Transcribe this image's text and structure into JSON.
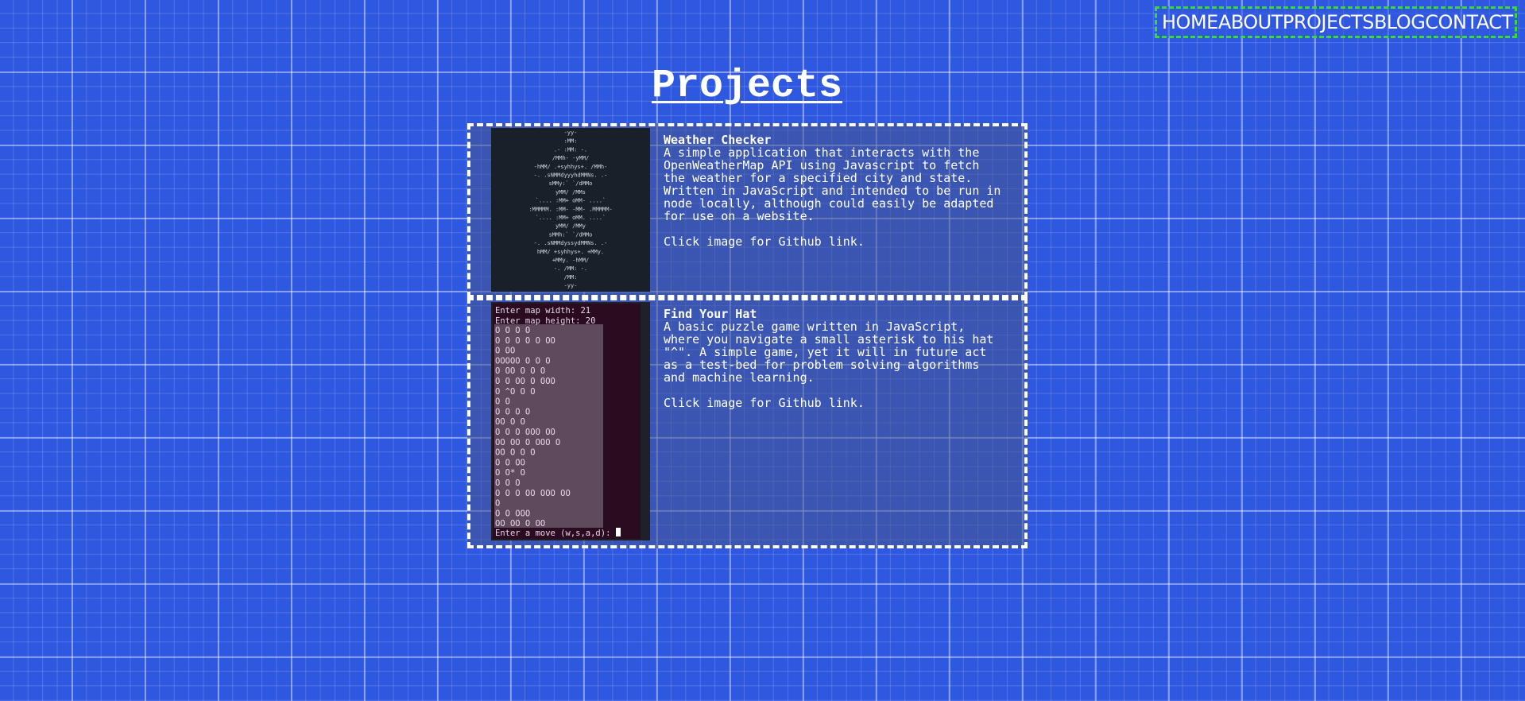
{
  "nav": {
    "items": [
      {
        "label": "HOME"
      },
      {
        "label": "ABOUT"
      },
      {
        "label": "PROJECTS"
      },
      {
        "label": "BLOG"
      },
      {
        "label": "CONTACT"
      }
    ]
  },
  "page": {
    "title": "Projects"
  },
  "projects": [
    {
      "title": "Weather Checker",
      "description": "A simple application that interacts with the OpenWeatherMap API using Javascript to fetch the weather for a specified city and state. Written in JavaScript and intended to be run in node locally, although could easily be adapted for use on a website.",
      "link_note": "Click image for Github link.",
      "image": {
        "ascii": [
          "-yy-",
          ":MM:",
          ".-         :MM:         -.",
          "/MMh-                  -yMM/",
          "-hMM/  .+syhhys+.  /MMh-",
          "-. .sNMMdyyyhdMMNs. .-",
          "sMMy:`       `/dMMo",
          "yMM/            /MMs",
          "`....  :MM+               oMM- ....`",
          ":MMMMM. :MM-              -MM- .MMMMM-",
          "`....  :MM+               oMM. ....`",
          "yMM/            /MMy",
          "sMMh:`        `/dMMo",
          "-. .sNMMdyssydMMNs. .-",
          "hMM/   +syhhys+.  +MMy.",
          "+MMy.                  -hMM/",
          "-.        /MM:        -.",
          "/MM:",
          "-yy-"
        ]
      }
    },
    {
      "title": "Find Your Hat",
      "description": "A basic puzzle game written in JavaScript, where you navigate a small asterisk to his hat \"^\". A simple game, yet it will in future act as a test-bed for problem solving algorithms and machine learning.",
      "link_note": "Click image for Github link.",
      "image": {
        "prompt_width": "Enter map width: 21",
        "prompt_height": "Enter map height: 20",
        "map": [
          "      O  O        O O",
          "O O O  O    O  OO    ",
          "  O       OO         ",
          "OOOOO O O  O         ",
          "   O OO   O   O  O   ",
          "O  O OO      O  OOO  ",
          "  O  ^O   O        O ",
          "           O O       ",
          "O      O      O   O  ",
          "     OO   O     O    ",
          " O O O OOO  OO       ",
          "   OO   OO  O OOO  O ",
          "          OO O  O  O ",
          "O              O  OO ",
          "             O  O*  O",
          "    O            O O ",
          "O  O O OO    OOO  OO ",
          "               O     ",
          " O        O     OOO  ",
          "   OO          OO O OO"
        ],
        "move_prompt": "Enter a move (w,s,a,d): "
      }
    }
  ]
}
